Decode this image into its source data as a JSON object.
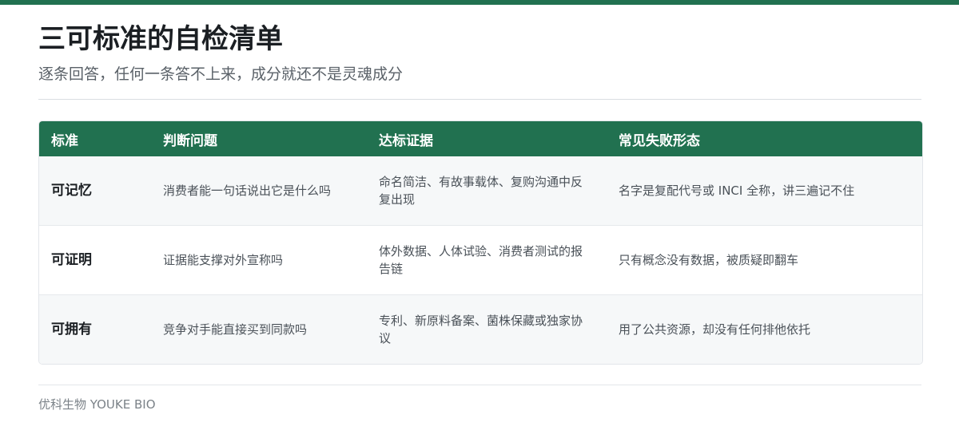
{
  "page": {
    "title": "三可标准的自检清单",
    "subtitle": "逐条回答，任何一条答不上来，成分就还不是灵魂成分",
    "accent_color": "#217150"
  },
  "table": {
    "headers": [
      "标准",
      "判断问题",
      "达标证据",
      "常见失败形态"
    ],
    "rows": [
      {
        "standard": "可记忆",
        "question": "消费者能一句话说出它是什么吗",
        "evidence": "命名简洁、有故事载体、复购沟通中反复出现",
        "failure": "名字是复配代号或 INCI 全称，讲三遍记不住"
      },
      {
        "standard": "可证明",
        "question": "证据能支撑对外宣称吗",
        "evidence": "体外数据、人体试验、消费者测试的报告链",
        "failure": "只有概念没有数据，被质疑即翻车"
      },
      {
        "standard": "可拥有",
        "question": "竞争对手能直接买到同款吗",
        "evidence": "专利、新原料备案、菌株保藏或独家协议",
        "failure": "用了公共资源，却没有任何排他依托"
      }
    ]
  },
  "footer": {
    "brand": "优科生物 YOUKE BIO"
  }
}
